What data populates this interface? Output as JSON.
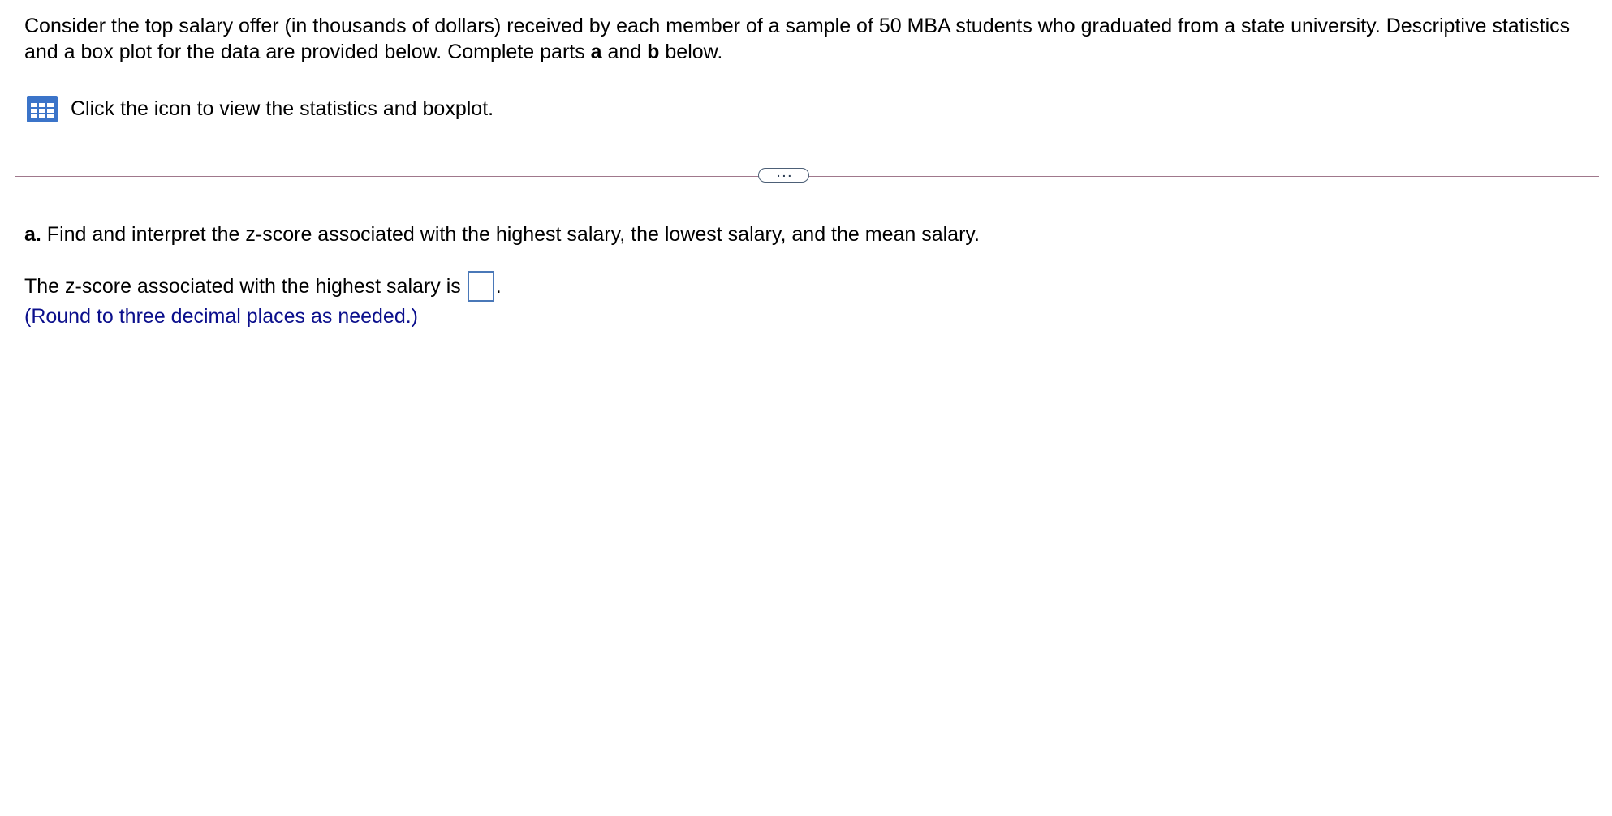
{
  "question": {
    "intro_part1": "Consider the top salary offer (in thousands of dollars) received by each member of a sample of 50 MBA students who graduated from a state university. Descriptive statistics and a box plot for the data are provided below. Complete parts ",
    "intro_bold_a": "a",
    "intro_and": " and ",
    "intro_bold_b": "b",
    "intro_end": " below."
  },
  "data_link": {
    "icon": "table-grid-icon",
    "text": "Click the icon to view the statistics and boxplot."
  },
  "divider": {
    "expand_label": "..."
  },
  "part_a": {
    "label": "a.",
    "text": " Find and interpret the z-score associated with the highest salary, the lowest salary, and the mean salary."
  },
  "answer": {
    "prompt": "The z-score associated with the highest salary is",
    "value": "",
    "period": ".",
    "hint": "(Round to three decimal places as needed.)"
  },
  "colors": {
    "hint_text": "#0b0f8c",
    "icon_blue": "#3b74c9",
    "divider": "#a0788c",
    "input_border": "#4a78b8"
  }
}
